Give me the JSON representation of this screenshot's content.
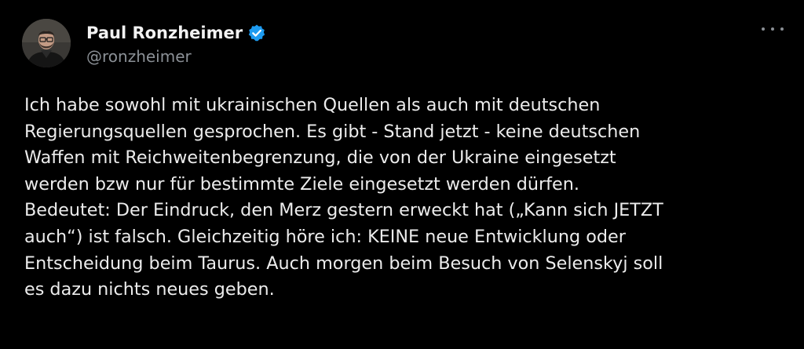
{
  "author": {
    "display_name": "Paul Ronzheimer",
    "handle": "@ronzheimer",
    "verified_icon": "verified-badge-icon",
    "avatar_icon": "profile-photo"
  },
  "menu": {
    "icon": "more-options-icon"
  },
  "tweet": {
    "lines": [
      "Ich habe sowohl mit ukrainischen Quellen als auch mit deutschen",
      "Regierungsquellen gesprochen. Es gibt - Stand jetzt - keine deutschen",
      "Waffen mit Reichweitenbegrenzung, die von der Ukraine eingesetzt",
      "werden bzw nur für bestimmte Ziele eingesetzt werden dürfen.",
      "Bedeutet: Der Eindruck, den Merz gestern erweckt hat („Kann sich JETZT",
      "auch“) ist falsch. Gleichzeitig höre ich: KEINE neue Entwicklung oder",
      "Entscheidung beim Taurus. Auch morgen beim Besuch von Selenskyj soll",
      "es dazu nichts neues geben."
    ]
  },
  "colors": {
    "background": "#000000",
    "text": "#e7e9ea",
    "secondary": "#8b9096",
    "verified": "#1d9bf0"
  }
}
